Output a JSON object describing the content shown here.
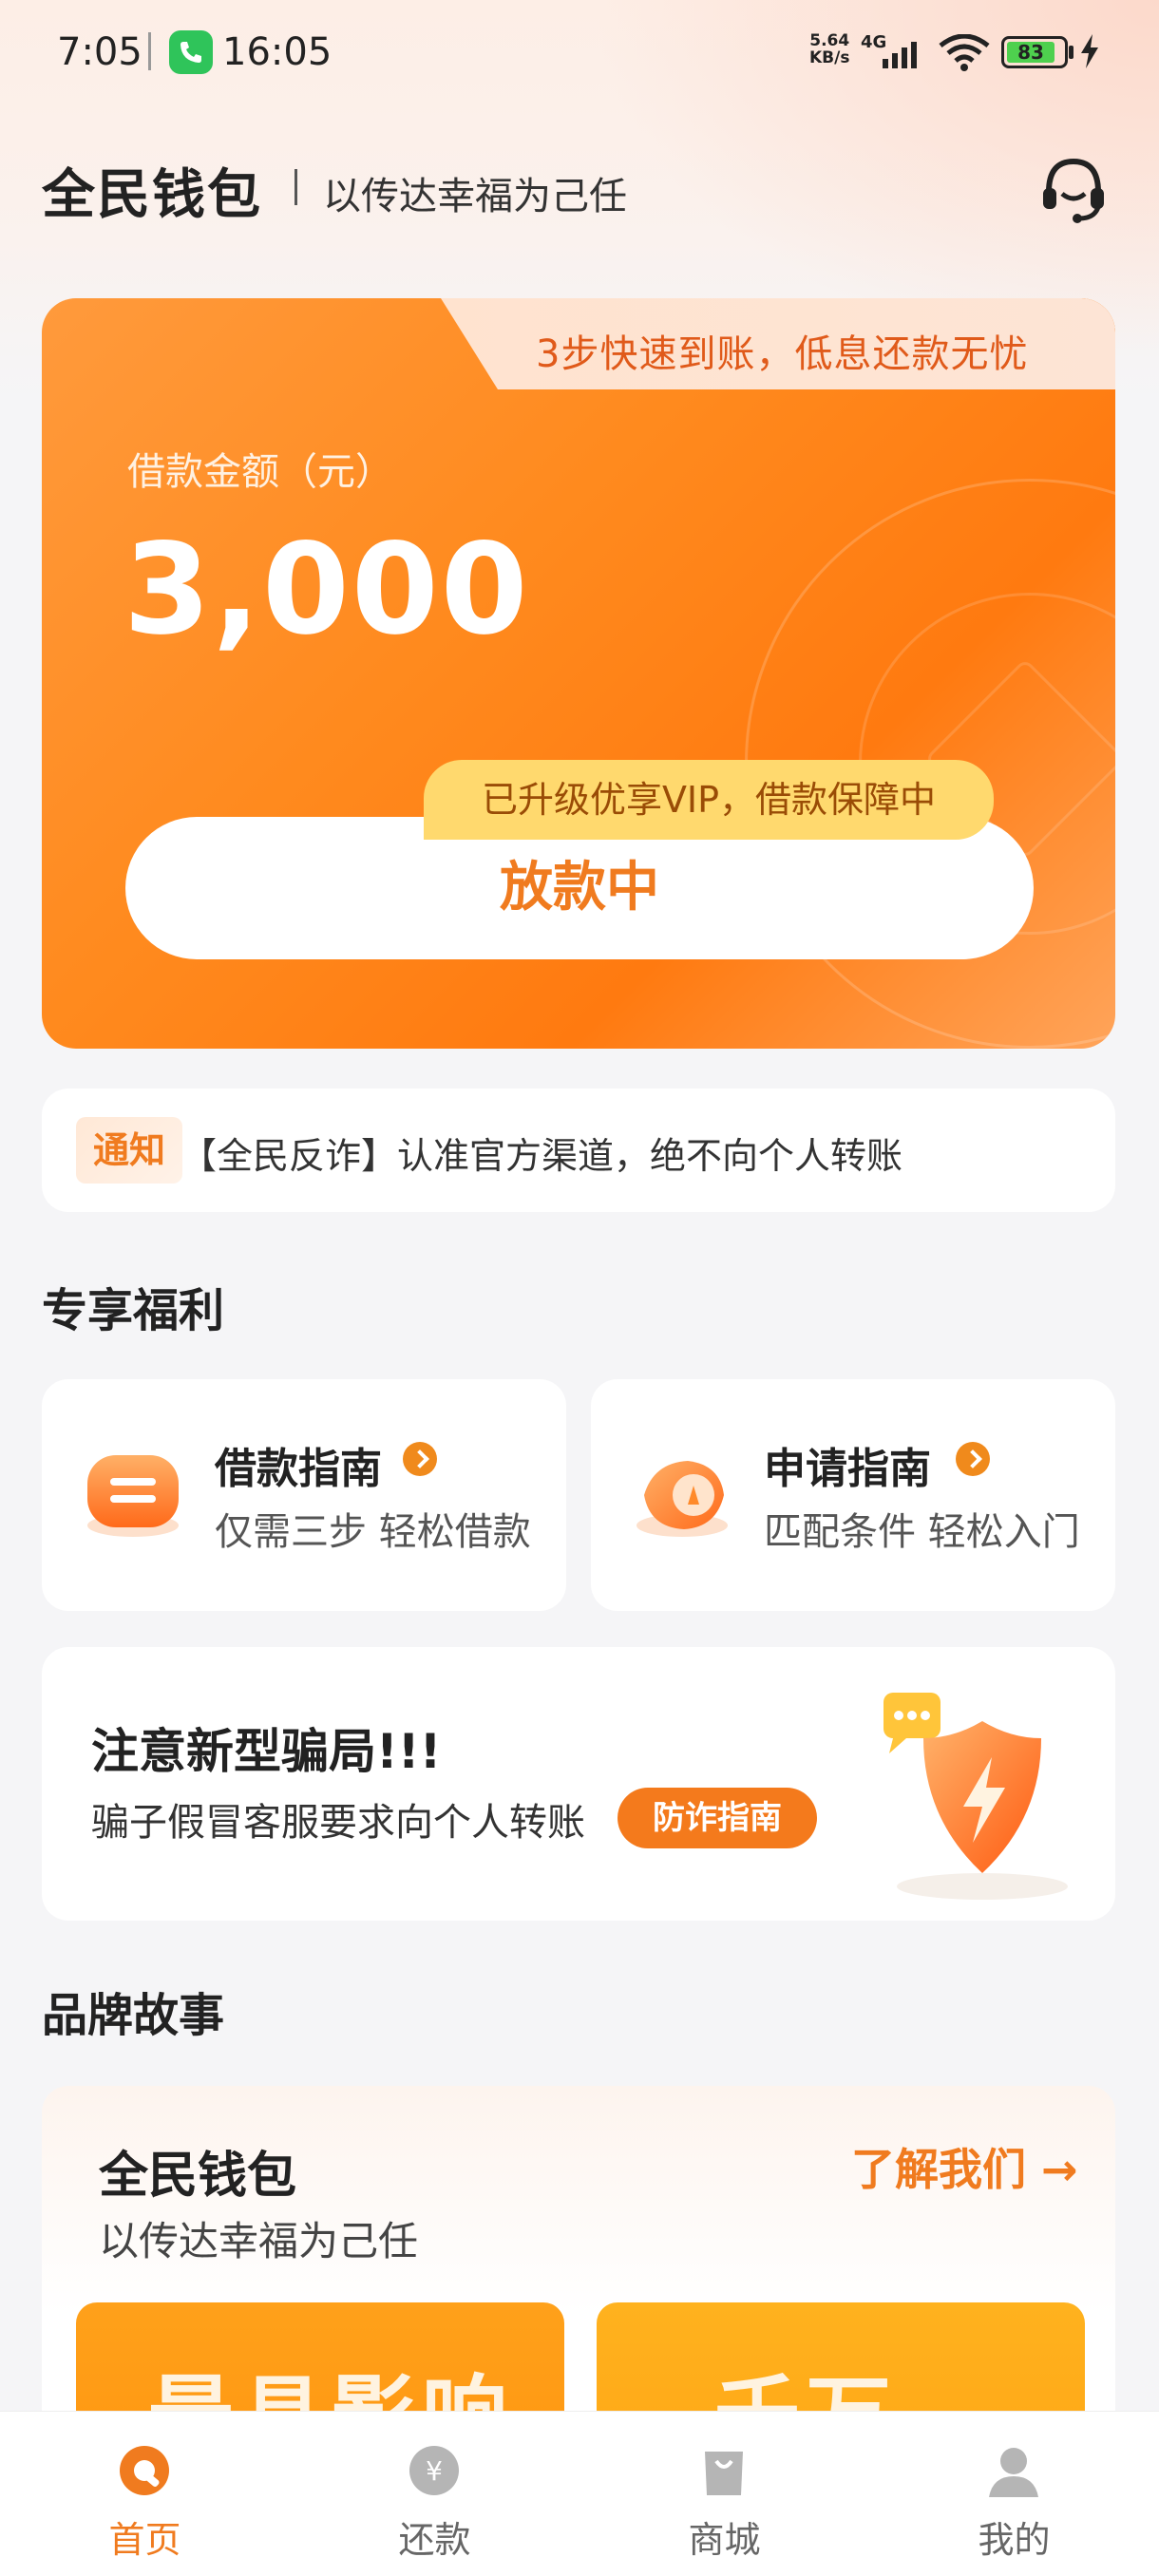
{
  "status_bar": {
    "time": "7:05",
    "call_time": "16:05",
    "speed": "5.64\nKB/s",
    "network": "4G",
    "battery": "83"
  },
  "header": {
    "brand": "全民钱包",
    "slogan": "以传达幸福为己任"
  },
  "loan_card": {
    "tip": "3步快速到账，低息还款无忧",
    "amount_label": "借款金额（元）",
    "amount": "3,000",
    "vip_badge": "已升级优享VIP，借款保障中",
    "status_button": "放款中"
  },
  "notice": {
    "tag": "通知",
    "text": "【全民反诈】认准官方渠道，绝不向个人转账"
  },
  "benefits": {
    "title": "专享福利",
    "guides": [
      {
        "title": "借款指南",
        "subtitle": "仅需三步 轻松借款"
      },
      {
        "title": "申请指南",
        "subtitle": "匹配条件 轻松入门"
      }
    ]
  },
  "scam": {
    "title": "注意新型骗局!!!",
    "subtitle": "骗子假冒客服要求向个人转账",
    "button": "防诈指南"
  },
  "story": {
    "section_title": "品牌故事",
    "title": "全民钱包",
    "subtitle": "以传达幸福为己任",
    "link": "了解我们 →",
    "image1_text": "最具影响力",
    "image2_text": "千万"
  },
  "nav": {
    "items": [
      {
        "label": "首页",
        "icon": "home-icon",
        "active": true
      },
      {
        "label": "还款",
        "icon": "repay-icon",
        "active": false
      },
      {
        "label": "商城",
        "icon": "shop-icon",
        "active": false
      },
      {
        "label": "我的",
        "icon": "profile-icon",
        "active": false
      }
    ]
  },
  "colors": {
    "accent": "#f07b1f",
    "card_orange": "#ff8a1e",
    "vip_yellow": "#ffd96e"
  }
}
